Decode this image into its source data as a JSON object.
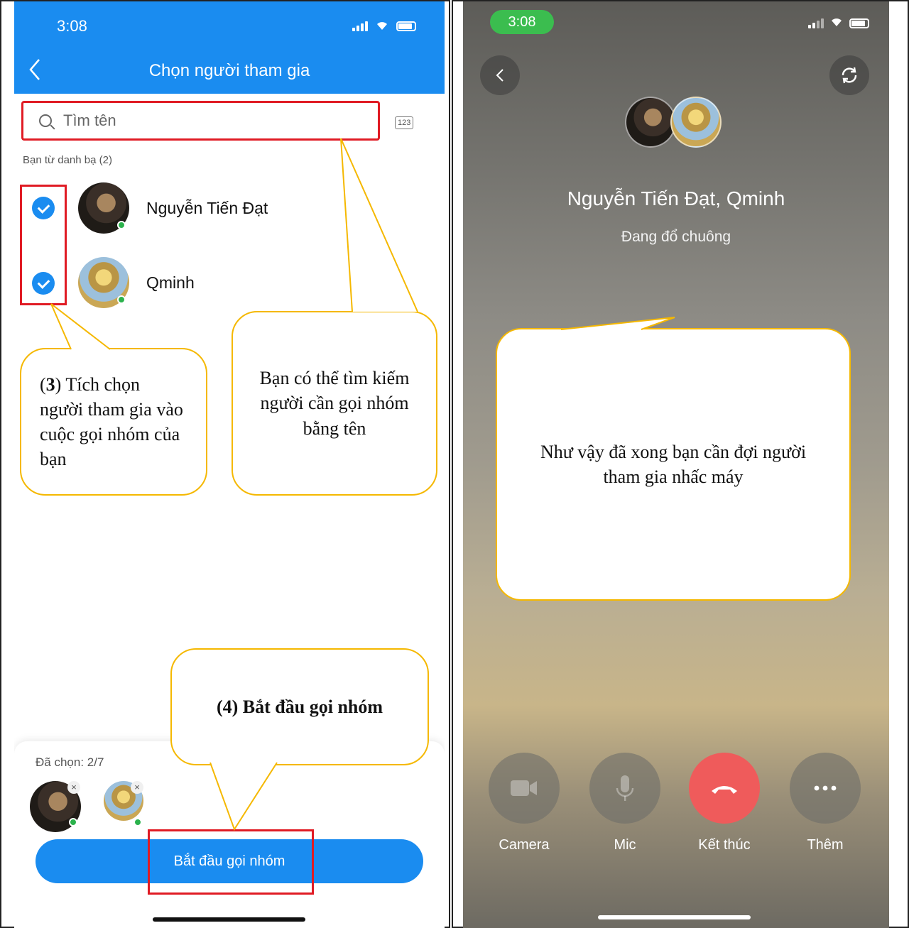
{
  "left": {
    "status_time": "3:08",
    "title": "Chọn người tham gia",
    "search_placeholder": "Tìm tên",
    "keypad_label": "123",
    "section_label": "Bạn từ danh bạ (2)",
    "contacts": [
      {
        "name": "Nguyễn Tiến Đạt",
        "checked": true,
        "online": true
      },
      {
        "name": "Qminh",
        "checked": true,
        "online": true
      }
    ],
    "selected_label": "Đã chọn: 2/7",
    "start_button": "Bắt đầu gọi nhóm",
    "accent_color": "#1a8cf0"
  },
  "callouts": {
    "step3_num": "3",
    "step3_text": "Tích chọn người tham gia vào cuộc gọi nhóm của bạn",
    "search_hint": "Bạn có thể tìm kiếm người cần gọi nhóm bằng tên",
    "step4_num": "4",
    "step4_text": "Bắt đầu gọi nhóm",
    "wait_text": "Như vậy đã xong bạn cần đợi người tham gia nhấc máy",
    "border_color": "#f5b800"
  },
  "right": {
    "status_time": "3:08",
    "call_names": "Nguyễn Tiến Đạt, Qminh",
    "call_status": "Đang đổ chuông",
    "controls": [
      {
        "label": "Camera",
        "icon": "video-camera-icon"
      },
      {
        "label": "Mic",
        "icon": "microphone-icon"
      },
      {
        "label": "Kết thúc",
        "icon": "end-call-icon"
      },
      {
        "label": "Thêm",
        "icon": "more-icon"
      }
    ],
    "end_call_color": "#ef5b5b"
  }
}
